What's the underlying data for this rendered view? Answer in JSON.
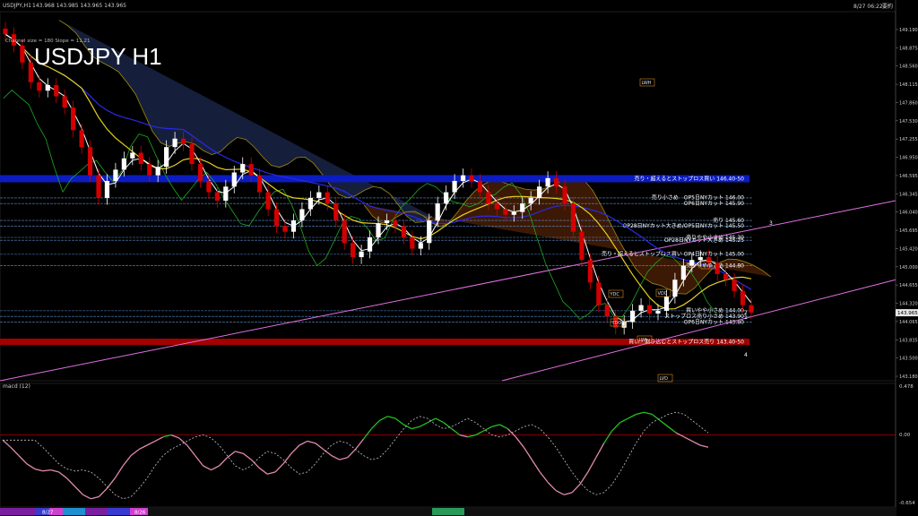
{
  "window": {
    "title": "USDJPY,H1",
    "ohlc": "143.968 143.985 143.965 143.965",
    "datetime": "8/27 06:22",
    "extra": "要約"
  },
  "chart_title": "USDJPY H1",
  "subtitle": "Channel size = 180 Slope = 11.21",
  "chart_data": {
    "type": "line",
    "symbol": "USDJPY",
    "timeframe": "H1",
    "ylim": [
      142.76,
      149.3
    ],
    "price_axis_ticks": [
      "149.190",
      "148.875",
      "148.560",
      "148.115",
      "147.860",
      "147.530",
      "147.255",
      "146.950",
      "146.595",
      "146.345",
      "146.040",
      "145.695",
      "145.420",
      "145.000",
      "144.655",
      "144.320",
      "144.065",
      "143.835",
      "143.500",
      "143.180"
    ],
    "current_price": 143.965,
    "x_labels": [
      "8/27",
      "8/26"
    ],
    "close": [
      148.9,
      148.7,
      148.4,
      148.05,
      147.9,
      148.0,
      147.8,
      147.6,
      147.2,
      146.9,
      146.4,
      146.0,
      146.3,
      146.5,
      146.7,
      146.8,
      146.6,
      146.4,
      146.55,
      146.9,
      147.05,
      146.95,
      146.6,
      146.3,
      146.1,
      145.95,
      146.2,
      146.45,
      146.6,
      146.4,
      146.1,
      145.8,
      145.5,
      145.4,
      145.6,
      145.8,
      146.0,
      146.1,
      145.9,
      145.6,
      145.2,
      144.95,
      145.05,
      145.3,
      145.55,
      145.6,
      145.5,
      145.3,
      145.1,
      145.2,
      145.6,
      145.9,
      146.1,
      146.3,
      146.4,
      146.3,
      146.1,
      145.9,
      145.8,
      145.7,
      145.75,
      145.9,
      146.0,
      146.2,
      146.35,
      146.2,
      145.9,
      145.4,
      144.9,
      144.5,
      144.1,
      143.9,
      143.7,
      143.8,
      144.0,
      144.1,
      143.95,
      144.0,
      144.25,
      144.55,
      144.8,
      144.9,
      144.95,
      144.85,
      144.65,
      144.55,
      144.35,
      144.1,
      143.97
    ],
    "horizontal_levels": [
      {
        "price": 146.34,
        "label": "売り・超えるとストップロス買い 146.40-50",
        "kind": "band-blue"
      },
      {
        "price": 146.0,
        "label": "売り小さめ　OP5日NYカット 146.00",
        "kind": "line"
      },
      {
        "price": 145.9,
        "label": "OP6日NYカット 145.90",
        "kind": "line"
      },
      {
        "price": 145.6,
        "label": "売り 145.60",
        "kind": "line"
      },
      {
        "price": 145.5,
        "label": "OP28日NYカット大きめ/OP5日NYカット 145.50",
        "kind": "line"
      },
      {
        "price": 145.3,
        "label": "売りやや小さめ 145.30",
        "kind": "line"
      },
      {
        "price": 145.25,
        "label": "OP28日NYカット大きめ 145.25",
        "kind": "line"
      },
      {
        "price": 145.0,
        "label": "売り・超えるとストップロス買い OP4日NYカット 145.00",
        "kind": "line"
      },
      {
        "price": 144.8,
        "label": "売りやや小さめ 144.80",
        "kind": "line"
      },
      {
        "price": 144.0,
        "label": "買いやや小さめ 144.00",
        "kind": "line"
      },
      {
        "price": 143.9,
        "label": "ストップロス売り小さめ 143.90",
        "kind": "line"
      },
      {
        "price": 143.8,
        "label": "OP6日NYカット 143.80",
        "kind": "line"
      },
      {
        "price": 143.45,
        "label": "買い・割り込むとストップロス売り 143.40-50",
        "kind": "band-red"
      }
    ],
    "right_markers": [
      "3",
      "2",
      "1",
      "4"
    ],
    "box_labels": [
      "LWH",
      "HVD",
      "YDC",
      "YDO",
      "VDC",
      "LWL",
      "LVD"
    ],
    "colors": {
      "background": "#000000",
      "bull": "#ffffff",
      "bear": "#d40000",
      "ma_fast": "#ffffff",
      "ma_mid": "#e8d020",
      "ma_slow": "#2a2ae8",
      "channel": "#e070e0",
      "cloud_blue": "#4a6fd8",
      "cloud_orange": "#d85a10",
      "span_olive": "#a08a10",
      "chikou": "#1fa81f",
      "band_blue": "#0c1cc0",
      "band_red": "#a50000"
    }
  },
  "macd": {
    "label": "macd (12)",
    "zero_label": "0.00",
    "axis_top": "0.478",
    "axis_bottom": "-0.654",
    "main": [
      -0.05,
      -0.12,
      -0.2,
      -0.28,
      -0.33,
      -0.35,
      -0.34,
      -0.36,
      -0.42,
      -0.5,
      -0.58,
      -0.62,
      -0.6,
      -0.52,
      -0.42,
      -0.3,
      -0.2,
      -0.14,
      -0.1,
      -0.06,
      -0.02,
      0.0,
      -0.03,
      -0.1,
      -0.2,
      -0.3,
      -0.34,
      -0.3,
      -0.22,
      -0.16,
      -0.18,
      -0.24,
      -0.32,
      -0.38,
      -0.36,
      -0.28,
      -0.18,
      -0.1,
      -0.06,
      -0.08,
      -0.14,
      -0.2,
      -0.24,
      -0.22,
      -0.14,
      -0.04,
      0.06,
      0.14,
      0.18,
      0.16,
      0.1,
      0.06,
      0.08,
      0.12,
      0.16,
      0.12,
      0.06,
      0.0,
      -0.02,
      0.0,
      0.04,
      0.08,
      0.1,
      0.06,
      -0.02,
      -0.12,
      -0.24,
      -0.36,
      -0.46,
      -0.54,
      -0.58,
      -0.56,
      -0.48,
      -0.36,
      -0.22,
      -0.08,
      0.04,
      0.12,
      0.16,
      0.2,
      0.22,
      0.2,
      0.14,
      0.08,
      0.02,
      -0.02,
      -0.06,
      -0.1,
      -0.12
    ],
    "signal_offset": 4
  },
  "bottom_bar": {
    "labels": [
      "8/27",
      "8/26"
    ]
  }
}
